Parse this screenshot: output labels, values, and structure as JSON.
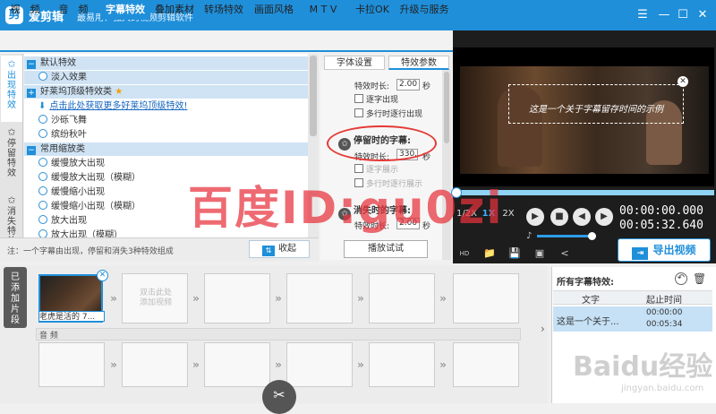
{
  "app": {
    "name": "爱剪辑",
    "slogan": "最易用、强大的视频剪辑软件",
    "logo_glyph": "剪"
  },
  "window_controls": {
    "menu": "☰",
    "minimize": "—",
    "maximize": "☐",
    "close": "✕"
  },
  "tabs": [
    "视　频",
    "音　频",
    "字幕特效",
    "叠加素材",
    "转场特效",
    "画面风格",
    "M T V",
    "卡拉OK",
    "升级与服务"
  ],
  "active_tab": "字幕特效",
  "sidenav": [
    {
      "label": "出现特效",
      "icon": "✩"
    },
    {
      "label": "停留特效",
      "icon": "✩"
    },
    {
      "label": "消失特效",
      "icon": "✩"
    }
  ],
  "effects": {
    "groups": [
      {
        "title": "默认特效",
        "toggle": "−"
      },
      {
        "title": "好莱坞顶级特效类",
        "toggle": "+",
        "star": "★"
      },
      {
        "title": "常用缩放类",
        "toggle": "−"
      }
    ],
    "default_item": "淡入效果",
    "hollywood_link": "点击此处获取更多好莱坞顶级特效!",
    "hollywood_items": [
      "沙砾飞舞",
      "缤纷秋叶"
    ],
    "zoom_items": [
      "缓慢放大出现",
      "缓慢放大出现（模糊）",
      "缓慢缩小出现",
      "缓慢缩小出现（模糊）",
      "放大出现",
      "放大出现（模糊）"
    ]
  },
  "footer": {
    "note": "注：一个字幕由出现，停留和消失3种特效组成",
    "collapse_button": "收起",
    "collapse_icon": "⇅"
  },
  "props": {
    "tab_font": "字体设置",
    "tab_effect": "特效参数",
    "label_duration": "特效时长:",
    "unit_sec": "秒",
    "appear": {
      "duration": "2.00",
      "opt1": "逐字出现",
      "opt2": "多行时逐行出现"
    },
    "stay": {
      "title": "停留时的字幕:",
      "duration": "330.0",
      "opt1": "逐字展示",
      "opt2": "多行时逐行展示"
    },
    "vanish": {
      "title": "消失时的字幕:",
      "duration": "2.00"
    },
    "preview_button": "播放试试"
  },
  "player": {
    "subtitle": "这是一个关于字幕留存时间的示例",
    "speeds": [
      "1/2X",
      "1X",
      "2X"
    ],
    "active_speed": "1X",
    "time_current": "00:00:00.000",
    "time_total": "00:05:32.640",
    "volume_fraction": 0.88,
    "progress_fraction": 0,
    "export_button": "导出视频",
    "icons": {
      "fullscreen": "HD",
      "folder": "📁",
      "save": "💾",
      "screenshot": "▣",
      "share": "<",
      "play": "▶",
      "stop": "■",
      "prev": "◀",
      "next": "▶",
      "volume": "♪"
    }
  },
  "timeline": {
    "side_label": "已添加片段",
    "clip_label": "老虎是活的 7...",
    "add_hint": "双击此处添加视频",
    "audio_label": "音 频",
    "slot_arrow": "»",
    "scissors_icon": "✂"
  },
  "subs_list": {
    "title": "所有字幕特效:",
    "col_text": "文字",
    "col_time": "起止时间",
    "rows": [
      {
        "text": "这是一个关于...",
        "start": "00:00:00",
        "end": "00:05:34"
      }
    ],
    "reset_icon": "↶",
    "delete_icon": "🗑"
  },
  "watermarks": {
    "main": "百度ID:gu0zi",
    "baidu": "Baidu经验",
    "url": "jingyan.baidu.com"
  }
}
